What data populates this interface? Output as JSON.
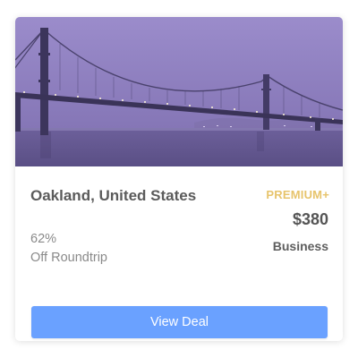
{
  "card": {
    "image_alt": "Bay bridge at dusk",
    "destination": "Oakland, United States",
    "discount_value": "62%",
    "discount_label": "Off Roundtrip",
    "tier": "PREMIUM+",
    "price": "$380",
    "cabin_class": "Business",
    "cta_label": "View Deal"
  },
  "colors": {
    "accent": "#6aa1ff",
    "tier": "#e7c46c",
    "sky": "#8e7fbf",
    "water": "#5f5389"
  }
}
